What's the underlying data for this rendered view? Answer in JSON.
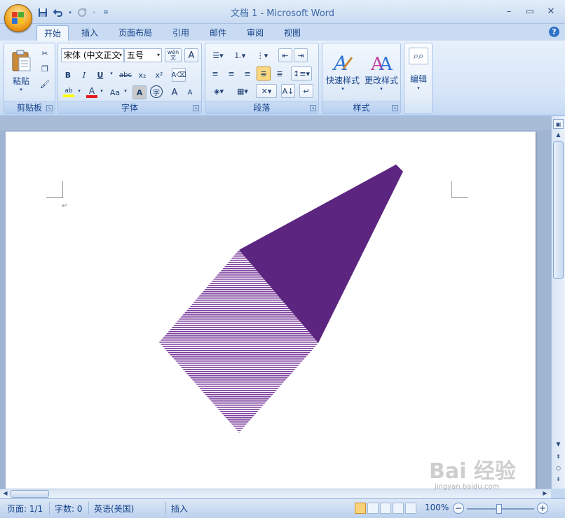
{
  "window": {
    "title": "文档 1 - Microsoft Word",
    "controls": [
      "minimize-icon",
      "maximize-icon",
      "close-icon"
    ]
  },
  "quick_access": [
    "save-icon",
    "undo-icon",
    "redo-icon",
    "customize-icon"
  ],
  "tabs": [
    {
      "label": "开始",
      "active": true
    },
    {
      "label": "插入"
    },
    {
      "label": "页面布局"
    },
    {
      "label": "引用"
    },
    {
      "label": "邮件"
    },
    {
      "label": "审阅"
    },
    {
      "label": "视图"
    }
  ],
  "ribbon": {
    "clipboard": {
      "label": "剪贴板",
      "paste_label": "粘贴"
    },
    "font": {
      "label": "字体",
      "font_name": "宋体 (中文正文",
      "font_size": "五号",
      "phonetic": "wén\n文",
      "border_char": "A",
      "bold": "B",
      "italic": "I",
      "underline": "U",
      "strikethrough": "abc",
      "subscript": "x₂",
      "superscript": "x²",
      "highlight": "ab",
      "font_color": "A",
      "change_case": "Aa",
      "char_shading": "A",
      "enclose": "字",
      "grow": "A",
      "shrink": "A"
    },
    "paragraph": {
      "label": "段落"
    },
    "styles": {
      "label": "样式",
      "quick_styles": "快速样式",
      "change_styles": "更改样式"
    },
    "editing": {
      "label": "编辑"
    }
  },
  "document": {
    "paragraph_mark": "↵",
    "shape_fill": "#5c2680",
    "shape_pattern": "#7a3d9c"
  },
  "statusbar": {
    "page": "页面: 1/1",
    "words": "字数: 0",
    "language": "英语(美国)",
    "mode": "插入",
    "zoom": "100%"
  },
  "watermark": {
    "text": "Bai 经验",
    "url": "jingyan.baidu.com"
  }
}
